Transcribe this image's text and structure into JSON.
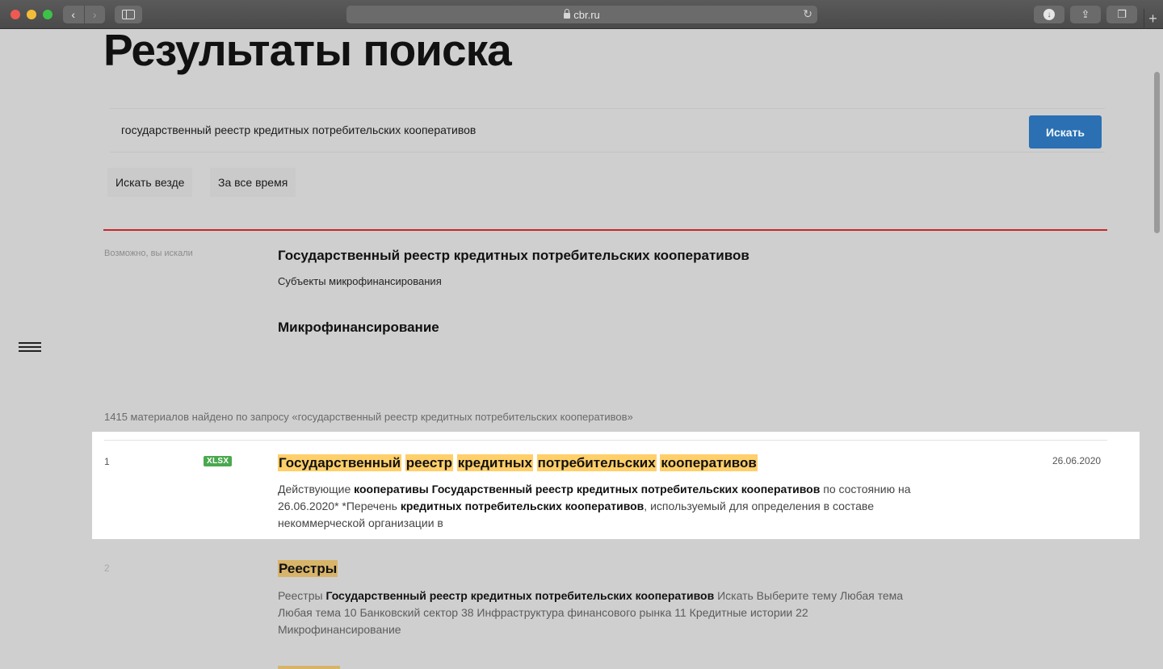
{
  "browser": {
    "url": "cbr.ru",
    "nav_back": "‹",
    "nav_forward": "›"
  },
  "page": {
    "title": "Результаты поиска",
    "search": {
      "query": "государственный реестр кредитных потребительских кооперативов",
      "button_label": "Искать"
    },
    "filters": [
      "Искать везде",
      "За все время"
    ],
    "suggestions": {
      "label": "Возможно, вы искали",
      "items": [
        {
          "title": "Государственный реестр кредитных потребительских кооперативов",
          "subtitle": "Субъекты микрофинансирования"
        },
        {
          "title": "Микрофинансирование",
          "subtitle": ""
        }
      ]
    },
    "results_count_text": "1415 материалов найдено по запросу «государственный реестр кредитных потребительских кооперативов»",
    "results": [
      {
        "number": "1",
        "badge": "XLSX",
        "title_words": [
          "Государственный",
          "реестр",
          "кредитных",
          "потребительских",
          "кооперативов"
        ],
        "date": "26.06.2020",
        "snippet_parts": [
          {
            "text": "Действующие ",
            "bold": false
          },
          {
            "text": "кооперативы Государственный реестр кредитных потребительских кооперативов",
            "bold": true
          },
          {
            "text": " по состоянию на 26.06.2020* *Перечень ",
            "bold": false
          },
          {
            "text": "кредитных потребительских кооперативов",
            "bold": true
          },
          {
            "text": ", используемый для определения в составе некоммерческой организации в",
            "bold": false
          }
        ]
      },
      {
        "number": "2",
        "badge": "",
        "title_words": [
          "Реестры"
        ],
        "date": "",
        "snippet_parts": [
          {
            "text": "Реестры ",
            "bold": false
          },
          {
            "text": "Государственный реестр кредитных потребительских кооперативов",
            "bold": true
          },
          {
            "text": " Искать Выберите тему Любая тема Любая тема 10 Банковский сектор 38 Инфраструктура финансового рынка 11 Кредитные истории 22 Микрофинансирование",
            "bold": false
          }
        ]
      }
    ]
  },
  "colors": {
    "accent_red": "#c7262b",
    "button_blue": "#2a70b3",
    "highlight": "#ffcf6a",
    "badge_green": "#4ba84f"
  }
}
